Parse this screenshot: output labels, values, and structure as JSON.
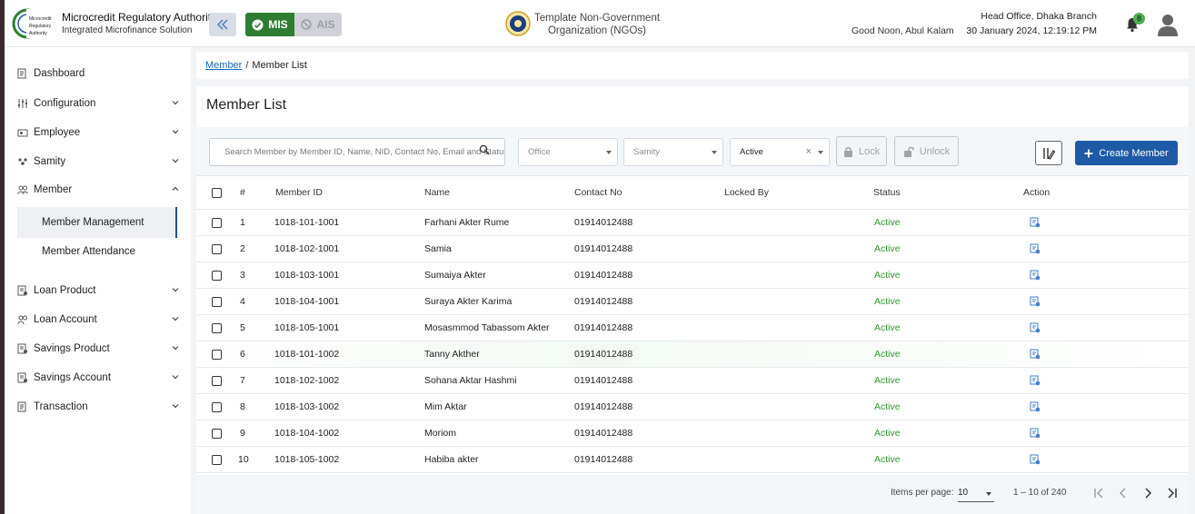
{
  "header": {
    "brand_title": "Microcredit Regulatory Authority",
    "brand_subtitle": "Integrated Microfinance Solution",
    "logo_text": "Microcredit Regulatory Authority",
    "mis_label": "MIS",
    "ais_label": "AIS",
    "org_name": "Template Non-Government Organization (NGOs)",
    "greeting": "Good Noon, Abul Kalam",
    "branch": "Head Office, Dhaka Branch",
    "datetime": "30 January 2024, 12:19:12 PM",
    "notification_count": "8"
  },
  "sidebar": {
    "items": [
      {
        "label": "Dashboard",
        "icon": "dashboard-icon"
      },
      {
        "label": "Configuration",
        "icon": "sliders-icon"
      },
      {
        "label": "Employee",
        "icon": "employee-icon"
      },
      {
        "label": "Samity",
        "icon": "samity-icon"
      },
      {
        "label": "Member",
        "icon": "member-icon"
      },
      {
        "label": "Loan Product",
        "icon": "loan-product-icon"
      },
      {
        "label": "Loan Account",
        "icon": "loan-account-icon"
      },
      {
        "label": "Savings Product",
        "icon": "savings-product-icon"
      },
      {
        "label": "Savings Account",
        "icon": "savings-account-icon"
      },
      {
        "label": "Transaction",
        "icon": "transaction-icon"
      }
    ],
    "member_sub": [
      "Member Management",
      "Member Attendance"
    ]
  },
  "breadcrumb": {
    "parent": "Member",
    "separator": "/",
    "current": "Member List"
  },
  "page_title": "Member List",
  "filters": {
    "search_placeholder": "Search Member by Member ID, Name, NID, Contact No, Email and Status",
    "office_placeholder": "Office",
    "samity_placeholder": "Samity",
    "status_value": "Active",
    "lock_label": "Lock",
    "unlock_label": "Unlock",
    "create_label": "Create Member"
  },
  "table": {
    "columns": [
      "#",
      "Member ID",
      "Name",
      "Contact No",
      "Locked By",
      "Status",
      "Action"
    ],
    "rows": [
      {
        "no": "1",
        "id": "1018-101-1001",
        "name": "Farhani Akter Rume",
        "contact": "01914012488",
        "locked_by": "",
        "status": "Active"
      },
      {
        "no": "2",
        "id": "1018-102-1001",
        "name": "Samia",
        "contact": "01914012488",
        "locked_by": "",
        "status": "Active"
      },
      {
        "no": "3",
        "id": "1018-103-1001",
        "name": "Sumaiya Akter",
        "contact": "01914012488",
        "locked_by": "",
        "status": "Active"
      },
      {
        "no": "4",
        "id": "1018-104-1001",
        "name": "Suraya Akter Karima",
        "contact": "01914012488",
        "locked_by": "",
        "status": "Active"
      },
      {
        "no": "5",
        "id": "1018-105-1001",
        "name": "Mosasmmod Tabassom Akter",
        "contact": "01914012488",
        "locked_by": "",
        "status": "Active"
      },
      {
        "no": "6",
        "id": "1018-101-1002",
        "name": "Tanny Akther",
        "contact": "01914012488",
        "locked_by": "",
        "status": "Active"
      },
      {
        "no": "7",
        "id": "1018-102-1002",
        "name": "Sohana Aktar Hashmi",
        "contact": "01914012488",
        "locked_by": "",
        "status": "Active"
      },
      {
        "no": "8",
        "id": "1018-103-1002",
        "name": "Mim Aktar",
        "contact": "01914012488",
        "locked_by": "",
        "status": "Active"
      },
      {
        "no": "9",
        "id": "1018-104-1002",
        "name": "Moriom",
        "contact": "01914012488",
        "locked_by": "",
        "status": "Active"
      },
      {
        "no": "10",
        "id": "1018-105-1002",
        "name": "Habiba akter",
        "contact": "01914012488",
        "locked_by": "",
        "status": "Active"
      }
    ]
  },
  "pagination": {
    "items_per_page_label": "Items per page:",
    "items_per_page": "10",
    "range": "1 – 10 of 240"
  },
  "colors": {
    "primary": "#1e5aa6",
    "mis_green": "#2e7d32",
    "status_green": "#2e9a2e",
    "link": "#1565c0"
  }
}
